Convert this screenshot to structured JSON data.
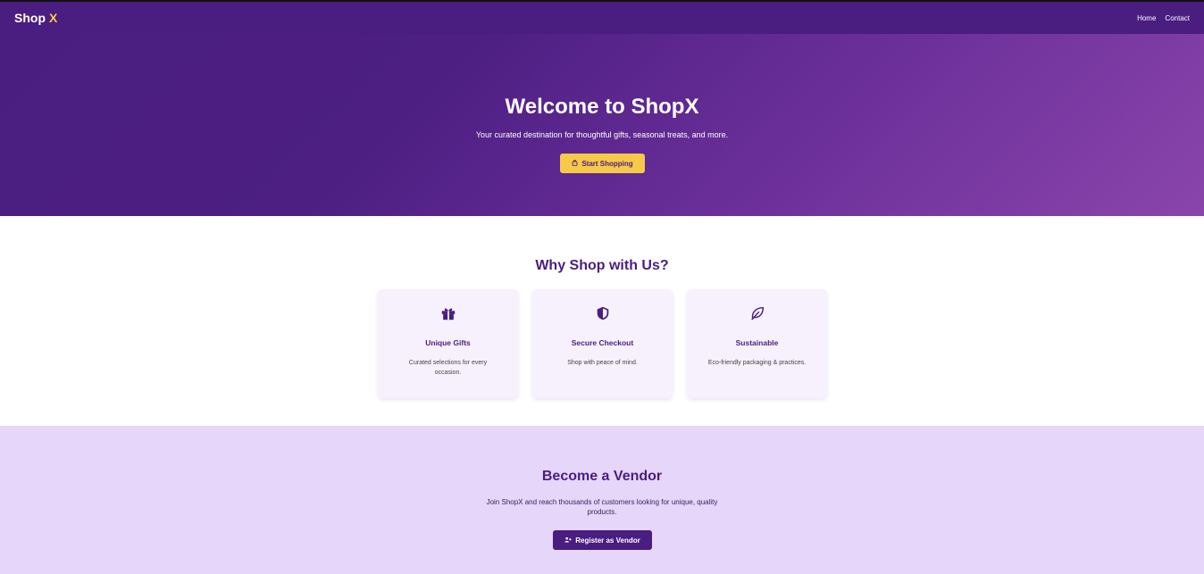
{
  "nav": {
    "brand_main": "Shop",
    "brand_accent": "X",
    "links": [
      "Home",
      "Contact"
    ]
  },
  "hero": {
    "title": "Welcome to ShopX",
    "subtitle": "Your curated destination for thoughtful gifts, seasonal treats, and more.",
    "button_label": "Start Shopping",
    "button_icon": "shopping-bag-icon"
  },
  "why": {
    "title": "Why Shop with Us?",
    "cards": [
      {
        "icon": "gift-icon",
        "title": "Unique Gifts",
        "text": "Curated selections for every occasion."
      },
      {
        "icon": "shield-icon",
        "title": "Secure Checkout",
        "text": "Shop with peace of mind."
      },
      {
        "icon": "leaf-icon",
        "title": "Sustainable",
        "text": "Eco-friendly packaging & practices."
      }
    ]
  },
  "vendor": {
    "title": "Become a Vendor",
    "text": "Join ShopX and reach thousands of customers looking for unique, quality products.",
    "button_label": "Register as Vendor",
    "button_icon": "user-plus-icon"
  },
  "colors": {
    "primary": "#4a1d80",
    "accent": "#f7c948",
    "card_bg": "#f6f1fd",
    "vendor_bg": "#e6d6f9"
  }
}
